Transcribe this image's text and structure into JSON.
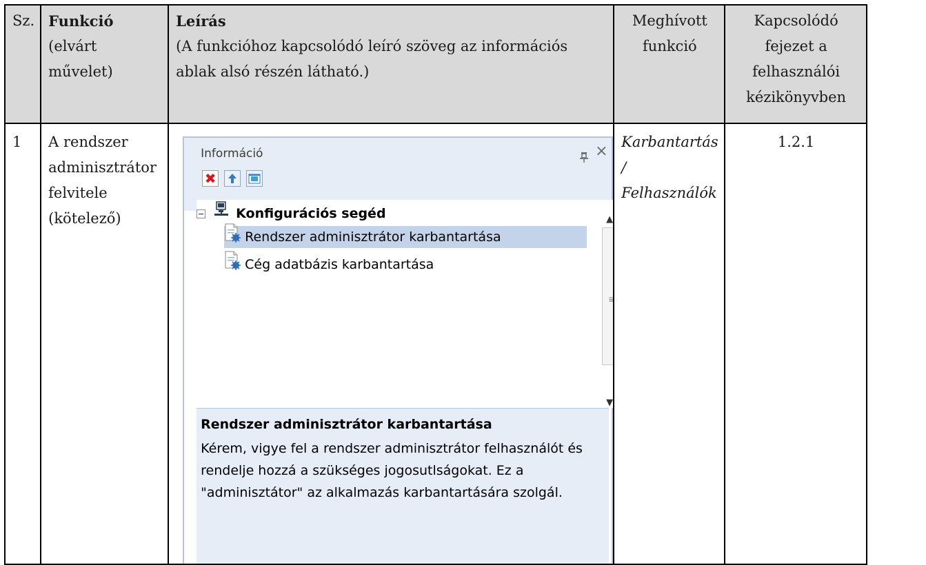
{
  "table": {
    "headers": {
      "sz": "Sz.",
      "funkcio_title": "Funkció",
      "funkcio_sub": "(elvárt művelet)",
      "leiras_title": "Leírás",
      "leiras_sub": "(A funkcióhoz kapcsolódó leíró szöveg az információs ablak alsó részén látható.)",
      "meghivott": "Meghívott funkció",
      "kapcsolodo": "Kapcsolódó fejezet a felhasználói kézikönyvben"
    },
    "row1": {
      "sz": "1",
      "funkcio": "A rendszer adminisztrátor felvitele (kötelező)",
      "meghivott_line1": "Karbantartás /",
      "meghivott_line2": "Felhasználók",
      "fejezet": "1.2.1"
    }
  },
  "panel": {
    "title": "Információ",
    "pin_glyph": "ꟷ",
    "close_glyph": "×",
    "toolbar": {
      "delete_glyph": "✖"
    },
    "tree": {
      "expander_glyph": "−",
      "root_label": "Konfigurációs segéd",
      "items": [
        {
          "label": "Rendszer adminisztrátor karbantartása",
          "selected": true
        },
        {
          "label": "Cég adatbázis karbantartása",
          "selected": false
        }
      ],
      "scroll_up": "▲",
      "scroll_grip": "≡",
      "scroll_down": "▼"
    },
    "description": {
      "title": "Rendszer adminisztrátor karbantartása",
      "text": "Kérem, vigye fel a rendszer adminisztrátor felhasználót és rendelje hozzá a szükséges jogosutlságokat. Ez a \"adminisztátor\" az alkalmazás karbantartására szolgál."
    }
  },
  "colors": {
    "header_bg": "#d9d9d9",
    "panel_chrome": "#e6edf7",
    "selection": "#c3d4ea",
    "delete_red": "#d21c1c"
  }
}
